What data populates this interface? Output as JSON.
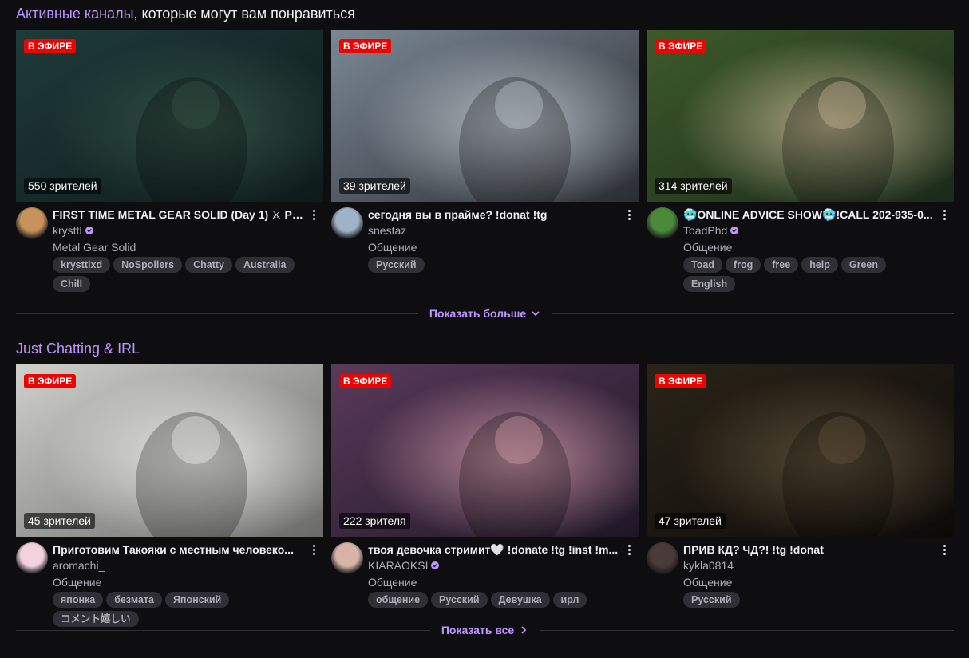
{
  "sections": [
    {
      "title_accent": "Активные каналы",
      "title_rest": ", которые могут вам понравиться",
      "show_more_label": "Показать больше",
      "cards": [
        {
          "live": "В ЭФИРЕ",
          "viewers": "550 зрителей",
          "title": "FIRST TIME METAL GEAR SOLID (Day 1) ⚔ PS...",
          "channel": "krysttl",
          "category": "Metal Gear Solid",
          "tags": [
            "krysttlxd",
            "NoSpoilers",
            "Chatty",
            "Australia",
            "Chill"
          ],
          "verified": true
        },
        {
          "live": "В ЭФИРЕ",
          "viewers": "39 зрителей",
          "title": "сегодня вы в прайме? !donat !tg",
          "channel": "snestaz",
          "category": "Общение",
          "tags": [
            "Русский"
          ],
          "verified": false
        },
        {
          "live": "В ЭФИРЕ",
          "viewers": "314 зрителей",
          "title": "🥶ONLINE ADVICE SHOW🥶!CALL 202-935-0...",
          "channel": "ToadPhd",
          "category": "Общение",
          "tags": [
            "Toad",
            "frog",
            "free",
            "help",
            "Green",
            "English"
          ],
          "verified": true
        }
      ]
    },
    {
      "title_accent": "Just Chatting & IRL",
      "title_rest": "",
      "show_more_label": "Показать все",
      "cards": [
        {
          "live": "В ЭФИРЕ",
          "viewers": "45 зрителей",
          "title": "Приготовим Такояки с местным человеко...",
          "channel": "aromachi_",
          "category": "Общение",
          "tags": [
            "японка",
            "безмата",
            "Японский",
            "コメント嬉しい"
          ],
          "verified": false
        },
        {
          "live": "В ЭФИРЕ",
          "viewers": "222 зрителя",
          "title": "твоя девочка стримит🤍 !donate !tg !inst !m...",
          "channel": "KIARAOKSI",
          "category": "Общение",
          "tags": [
            "общение",
            "Русский",
            "Девушка",
            "ирл"
          ],
          "verified": true
        },
        {
          "live": "В ЭФИРЕ",
          "viewers": "47 зрителей",
          "title": "ПРИВ КД? ЧД?! !tg !donat",
          "channel": "kykla0814",
          "category": "Общение",
          "tags": [
            "Русский"
          ],
          "verified": false
        }
      ]
    }
  ],
  "colors": {
    "accent": "#bf94ff",
    "live": "#eb0400",
    "background": "#0e0e10",
    "tag_bg": "#2f2f35"
  },
  "thumb_palettes": [
    [
      "#1f3a3a",
      "#0d1a1a",
      "#3a5a4a"
    ],
    [
      "#7b8894",
      "#2a2d33",
      "#cfd6dc"
    ],
    [
      "#3e5a2a",
      "#1a2a1a",
      "#d6c3a0"
    ],
    [
      "#cfd0cc",
      "#6a6a66",
      "#ffffff"
    ],
    [
      "#5a3a5a",
      "#1e1626",
      "#e3a9b6"
    ],
    [
      "#2a2418",
      "#0c0a08",
      "#6a5a40"
    ]
  ],
  "avatar_colors": [
    "#c8935a",
    "#9fb3c8",
    "#4a8a3a",
    "#f2d2dc",
    "#d8b4a8",
    "#4a3a3a"
  ]
}
